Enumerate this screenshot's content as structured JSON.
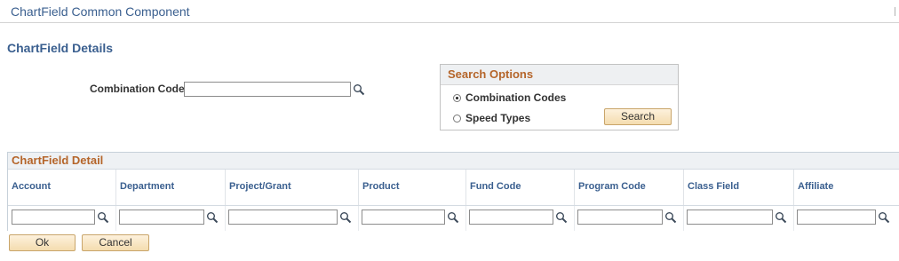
{
  "page": {
    "title": "ChartField Common Component"
  },
  "details": {
    "heading": "ChartField Details",
    "combination_code_label": "Combination Code",
    "combination_code_value": ""
  },
  "search_options": {
    "heading": "Search Options",
    "options": [
      {
        "label": "Combination Codes",
        "selected": true
      },
      {
        "label": "Speed Types",
        "selected": false
      }
    ],
    "search_button": "Search"
  },
  "grid": {
    "heading": "ChartField Detail",
    "columns": [
      "Account",
      "Department",
      "Project/Grant",
      "Product",
      "Fund Code",
      "Program Code",
      "Class Field",
      "Affiliate"
    ],
    "row": [
      "",
      "",
      "",
      "",
      "",
      "",
      "",
      ""
    ]
  },
  "footer": {
    "ok_label": "Ok",
    "cancel_label": "Cancel"
  },
  "icons": {
    "lookup": "magnifier-icon",
    "accent_color": "#b5652a",
    "title_color": "#3a5f8f"
  }
}
